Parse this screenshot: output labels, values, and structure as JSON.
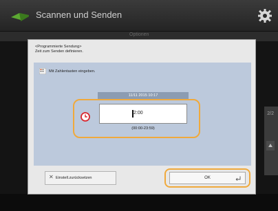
{
  "app": {
    "title": "Scannen und Senden",
    "strip_label": "Optionen",
    "side_number": "2/2"
  },
  "dialog": {
    "message_line1": "<Programmierte Sendung>",
    "message_line2": "Zeit zum Senden definieren.",
    "instruction": "Mit Zahlentasten eingeben.",
    "datetime": "11/11 2015 10:17",
    "time_value": "2:00",
    "range": "(00:00-23:59)",
    "reset_label": "Einstell.zurücksetzen",
    "ok_label": "OK"
  },
  "colors": {
    "highlight": "#f0a93b",
    "clock_icon": "#d9262d",
    "panel": "#bcc9dc"
  },
  "icons": [
    "scanner-logo-icon",
    "gear-icon",
    "keypad-icon",
    "clock-icon",
    "close-x-icon",
    "enter-return-icon",
    "arrow-up-icon"
  ]
}
